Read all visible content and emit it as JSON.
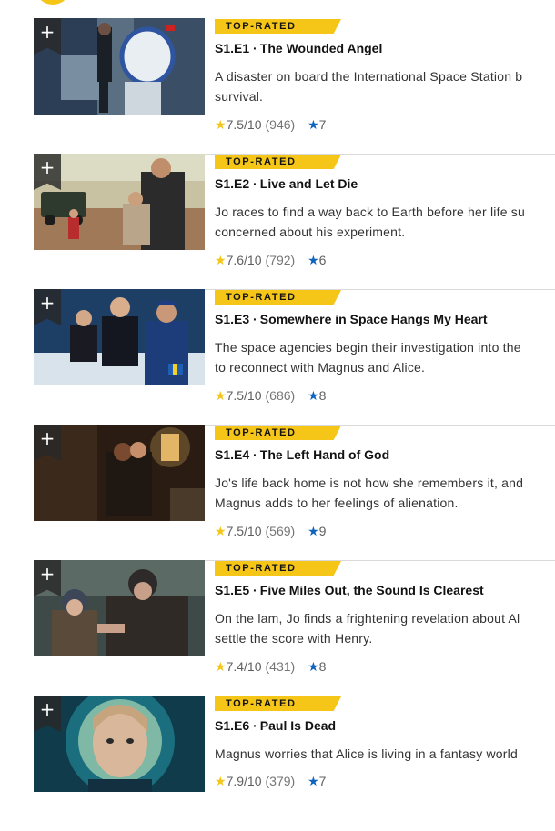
{
  "colors": {
    "accent": "#f5c518",
    "user_star": "#0e63be"
  },
  "icons": {
    "add": "plus-icon",
    "rating": "star-icon",
    "user_rating": "blue-star-icon"
  },
  "episodes": [
    {
      "badge": "TOP-RATED",
      "title": "S1.E1 ∙ The Wounded Angel",
      "desc_line1": "A disaster on board the International Space Station b",
      "desc_line2": "survival.",
      "rating": "7.5",
      "rating_max": "/10",
      "votes": "(946)",
      "user_rating": "7",
      "add_label": "+"
    },
    {
      "badge": "TOP-RATED",
      "title": "S1.E2 ∙ Live and Let Die",
      "desc_line1": "Jo races to find a way back to Earth before her life su",
      "desc_line2": "concerned about his experiment.",
      "rating": "7.6",
      "rating_max": "/10",
      "votes": "(792)",
      "user_rating": "6",
      "add_label": "+"
    },
    {
      "badge": "TOP-RATED",
      "title": "S1.E3 ∙ Somewhere in Space Hangs My Heart",
      "desc_line1": "The space agencies begin their investigation into the",
      "desc_line2": "to reconnect with Magnus and Alice.",
      "rating": "7.5",
      "rating_max": "/10",
      "votes": "(686)",
      "user_rating": "8",
      "add_label": "+"
    },
    {
      "badge": "TOP-RATED",
      "title": "S1.E4 ∙ The Left Hand of God",
      "desc_line1": "Jo's life back home is not how she remembers it, and",
      "desc_line2": "Magnus adds to her feelings of alienation.",
      "rating": "7.5",
      "rating_max": "/10",
      "votes": "(569)",
      "user_rating": "9",
      "add_label": "+"
    },
    {
      "badge": "TOP-RATED",
      "title": "S1.E5 ∙ Five Miles Out, the Sound Is Clearest",
      "desc_line1": "On the lam, Jo finds a frightening revelation about Al",
      "desc_line2": "settle the score with Henry.",
      "rating": "7.4",
      "rating_max": "/10",
      "votes": "(431)",
      "user_rating": "8",
      "add_label": "+"
    },
    {
      "badge": "TOP-RATED",
      "title": "S1.E6 ∙ Paul Is Dead",
      "desc_line1": "Magnus worries that Alice is living in a fantasy world",
      "desc_line2": "",
      "rating": "7.9",
      "rating_max": "/10",
      "votes": "(379)",
      "user_rating": "7",
      "add_label": "+"
    }
  ]
}
